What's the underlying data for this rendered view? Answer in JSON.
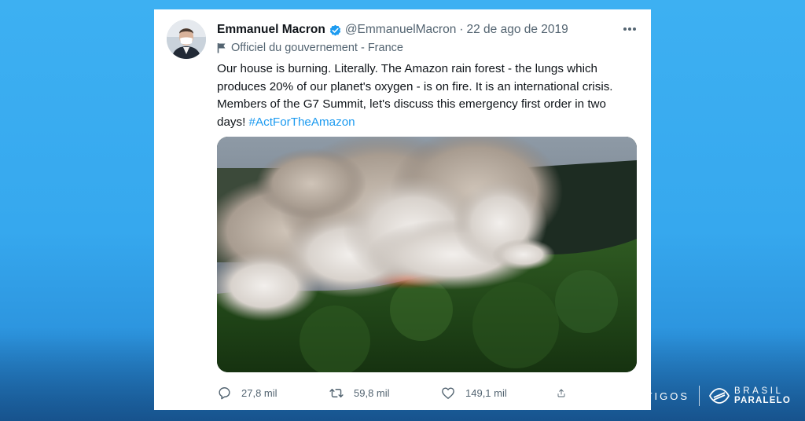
{
  "tweet": {
    "display_name": "Emmanuel Macron",
    "handle": "@EmmanuelMacron",
    "separator": "·",
    "date": "22 de ago de 2019",
    "affiliation": "Officiel du gouvernement - France",
    "text_lines": [
      "Our house is burning. Literally. The Amazon rain forest - the lungs which",
      "produces 20% of our planet's oxygen - is on fire. It is an international crisis.",
      "Members of the G7 Summit, let's discuss this emergency first order in two",
      "days! "
    ],
    "hashtag": "#ActForTheAmazon",
    "media_description_icon": "photo",
    "counts": {
      "replies": "27,8 mil",
      "retweets": "59,8 mil",
      "likes": "149,1 mil"
    }
  },
  "branding": {
    "section": "ARTIGOS",
    "logo_top": "BRASIL",
    "logo_bottom": "PARALELO"
  },
  "icons": [
    "verified-badge-icon",
    "flag-icon",
    "more-icon",
    "reply-icon",
    "retweet-icon",
    "like-icon",
    "share-icon",
    "brasil-paralelo-logo-icon"
  ],
  "colors": {
    "background": "#36a8ee",
    "link": "#1d9bf0",
    "verified": "#1d9bf0",
    "secondary_text": "#536471"
  }
}
